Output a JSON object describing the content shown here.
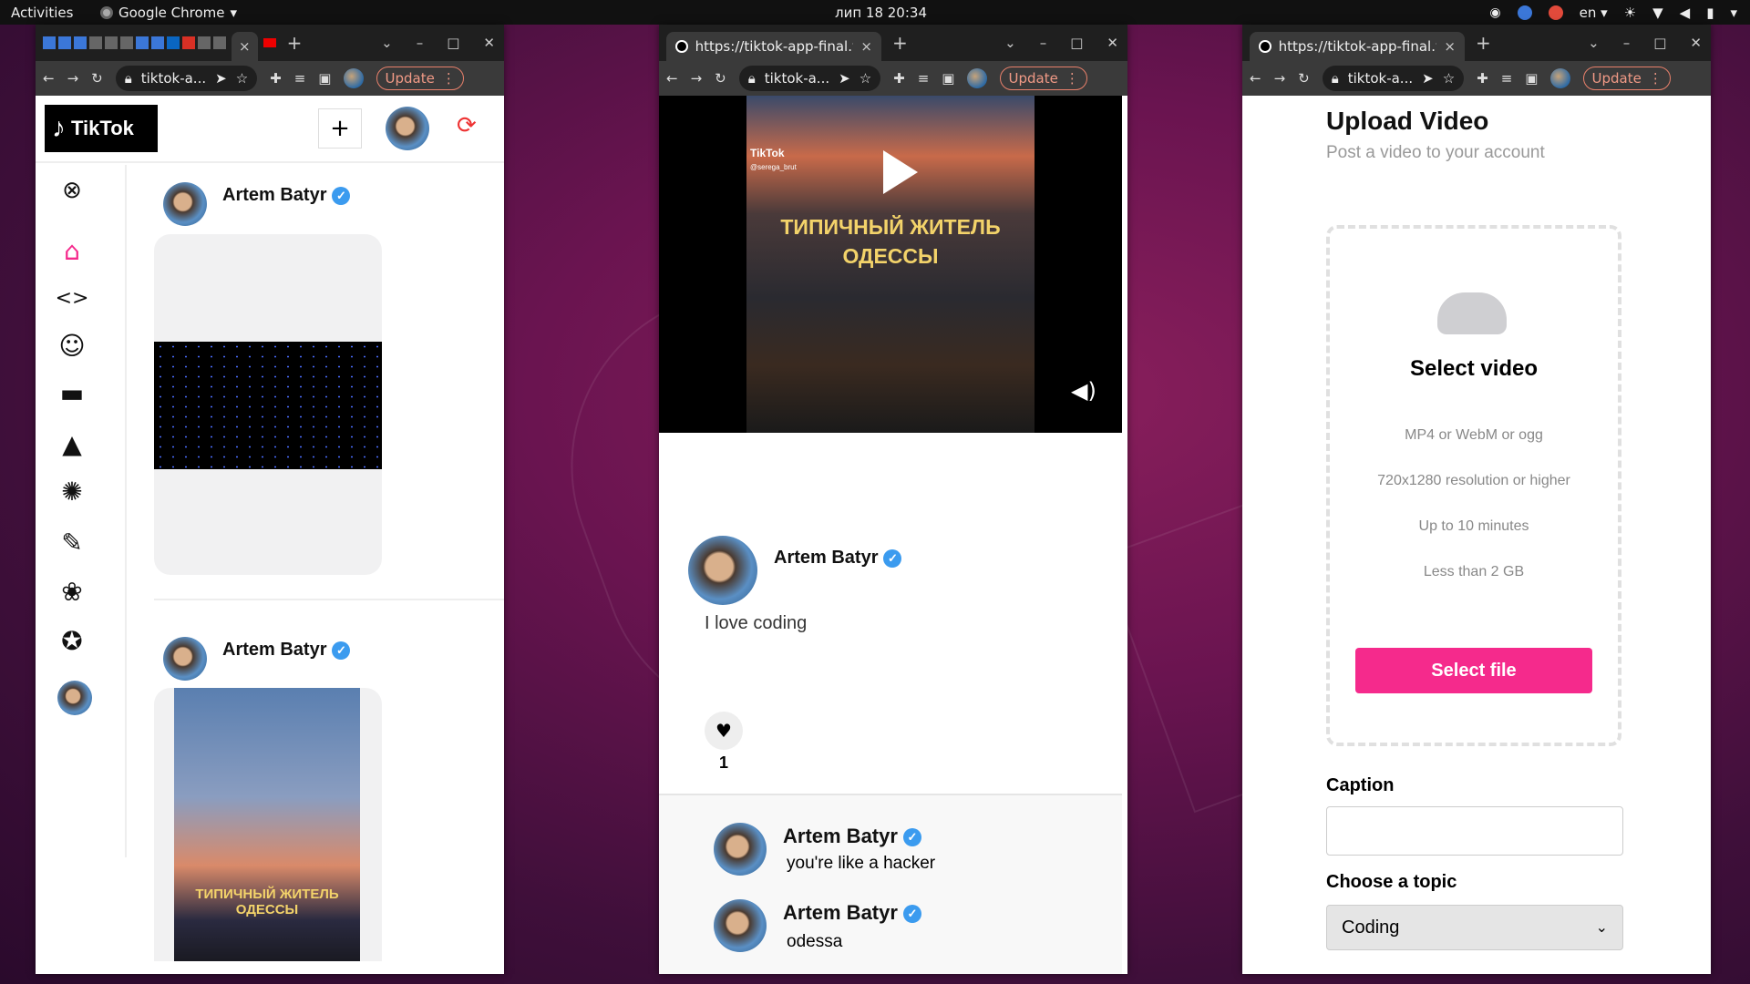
{
  "topbar": {
    "activities": "Activities",
    "app_name": "Google Chrome",
    "clock": "лип 18  20:34",
    "lang": "en"
  },
  "window1": {
    "tab_close": "×",
    "omnibox": "tiktok-a...",
    "update_label": "Update",
    "logo_text": "TikTok",
    "upload_icon_label": "+",
    "posts": [
      {
        "author": "Artem Batyr",
        "caption_overlay": ""
      },
      {
        "author": "Artem Batyr",
        "caption_overlay": "ТИПИЧНЫЙ ЖИТЕЛЬ ОДЕССЫ"
      }
    ],
    "sidebar_icons": [
      "close-circle-icon",
      "home-icon",
      "code-icon",
      "cool-face-icon",
      "gamepad-icon",
      "cake-icon",
      "spiral-icon",
      "lipstick-icon",
      "paw-icon",
      "medal-icon"
    ]
  },
  "window2": {
    "tab_title": "https://tiktok-app-final.v",
    "omnibox": "tiktok-a...",
    "update_label": "Update",
    "video_overlay": "ТИПИЧНЫЙ ЖИТЕЛЬ ОДЕССЫ",
    "watermark": "TikTok",
    "watermark_handle": "@serega_brut",
    "author": "Artem Batyr",
    "caption": "I love coding",
    "likes": "1",
    "comments": [
      {
        "author": "Artem Batyr",
        "text": "you're like a hacker"
      },
      {
        "author": "Artem Batyr",
        "text": "odessa"
      }
    ]
  },
  "window3": {
    "tab_title": "https://tiktok-app-final.v",
    "omnibox": "tiktok-a...",
    "update_label": "Update",
    "title": "Upload Video",
    "subtitle": "Post a video to your account",
    "select_video": "Select video",
    "requirements": [
      "MP4 or WebM or ogg",
      "720x1280 resolution or higher",
      "Up to 10 minutes",
      "Less than 2 GB"
    ],
    "select_file_button": "Select file",
    "caption_label": "Caption",
    "caption_value": "",
    "topic_label": "Choose a topic",
    "topic_selected": "Coding"
  },
  "colors": {
    "accent": "#f52a8c",
    "verified": "#3b9bef",
    "home": "#f52a8c"
  }
}
